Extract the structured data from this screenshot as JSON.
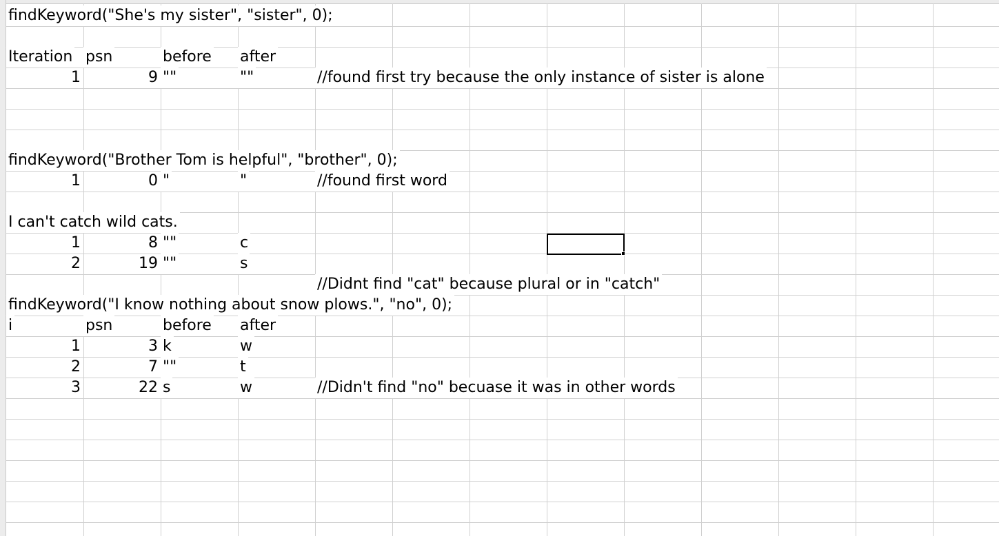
{
  "sheet": {
    "rows": [
      {
        "r": 1,
        "cells": [
          {
            "c": "A",
            "text": "findKeyword(\"She's my sister\", \"sister\", 0);"
          }
        ]
      },
      {
        "r": 2,
        "cells": []
      },
      {
        "r": 3,
        "cells": [
          {
            "c": "A",
            "text": "Iteration"
          },
          {
            "c": "B",
            "text": "psn"
          },
          {
            "c": "C",
            "text": "before"
          },
          {
            "c": "D",
            "text": "after"
          }
        ]
      },
      {
        "r": 4,
        "cells": [
          {
            "c": "A",
            "text": "1",
            "num": true
          },
          {
            "c": "B",
            "text": "9",
            "num": true
          },
          {
            "c": "C",
            "text": "\"\""
          },
          {
            "c": "D",
            "text": "\"\""
          },
          {
            "c": "E",
            "text": "//found first try because the only instance of sister is alone"
          }
        ]
      },
      {
        "r": 5,
        "cells": []
      },
      {
        "r": 6,
        "cells": []
      },
      {
        "r": 7,
        "cells": []
      },
      {
        "r": 8,
        "cells": [
          {
            "c": "A",
            "text": "findKeyword(\"Brother Tom is helpful\", \"brother\", 0);"
          }
        ]
      },
      {
        "r": 9,
        "cells": [
          {
            "c": "A",
            "text": "1",
            "num": true
          },
          {
            "c": "B",
            "text": "0",
            "num": true
          },
          {
            "c": "C",
            "text": "\""
          },
          {
            "c": "D",
            "text": "\""
          },
          {
            "c": "E",
            "text": "//found first word"
          }
        ]
      },
      {
        "r": 10,
        "cells": []
      },
      {
        "r": 11,
        "cells": [
          {
            "c": "A",
            "text": "I can't catch wild cats."
          }
        ]
      },
      {
        "r": 12,
        "cells": [
          {
            "c": "A",
            "text": "1",
            "num": true
          },
          {
            "c": "B",
            "text": "8",
            "num": true
          },
          {
            "c": "C",
            "text": "\"\""
          },
          {
            "c": "D",
            "text": "c"
          }
        ]
      },
      {
        "r": 13,
        "cells": [
          {
            "c": "A",
            "text": "2",
            "num": true
          },
          {
            "c": "B",
            "text": "19",
            "num": true
          },
          {
            "c": "C",
            "text": "\"\""
          },
          {
            "c": "D",
            "text": "s"
          }
        ]
      },
      {
        "r": 14,
        "cells": [
          {
            "c": "E",
            "text": "//Didnt find \"cat\" because plural or in \"catch\""
          }
        ]
      },
      {
        "r": 15,
        "cells": [
          {
            "c": "A",
            "text": "findKeyword(\"I know nothing about snow plows.\", \"no\", 0);"
          }
        ]
      },
      {
        "r": 16,
        "cells": [
          {
            "c": "A",
            "text": "i"
          },
          {
            "c": "B",
            "text": "psn"
          },
          {
            "c": "C",
            "text": "before"
          },
          {
            "c": "D",
            "text": "after"
          }
        ]
      },
      {
        "r": 17,
        "cells": [
          {
            "c": "A",
            "text": "1",
            "num": true
          },
          {
            "c": "B",
            "text": "3",
            "num": true
          },
          {
            "c": "C",
            "text": "k"
          },
          {
            "c": "D",
            "text": "w"
          }
        ]
      },
      {
        "r": 18,
        "cells": [
          {
            "c": "A",
            "text": "2",
            "num": true
          },
          {
            "c": "B",
            "text": "7",
            "num": true
          },
          {
            "c": "C",
            "text": "\"\""
          },
          {
            "c": "D",
            "text": "t"
          }
        ]
      },
      {
        "r": 19,
        "cells": [
          {
            "c": "A",
            "text": "3",
            "num": true
          },
          {
            "c": "B",
            "text": "22",
            "num": true
          },
          {
            "c": "C",
            "text": "s"
          },
          {
            "c": "D",
            "text": "w"
          },
          {
            "c": "E",
            "text": "//Didn't find \"no\" becuase it was in other words"
          }
        ]
      }
    ],
    "selected": {
      "c": "H",
      "r": 12
    },
    "colors": {
      "grid": "#d0d0d0",
      "text": "#000000",
      "selection": "#000000"
    }
  }
}
